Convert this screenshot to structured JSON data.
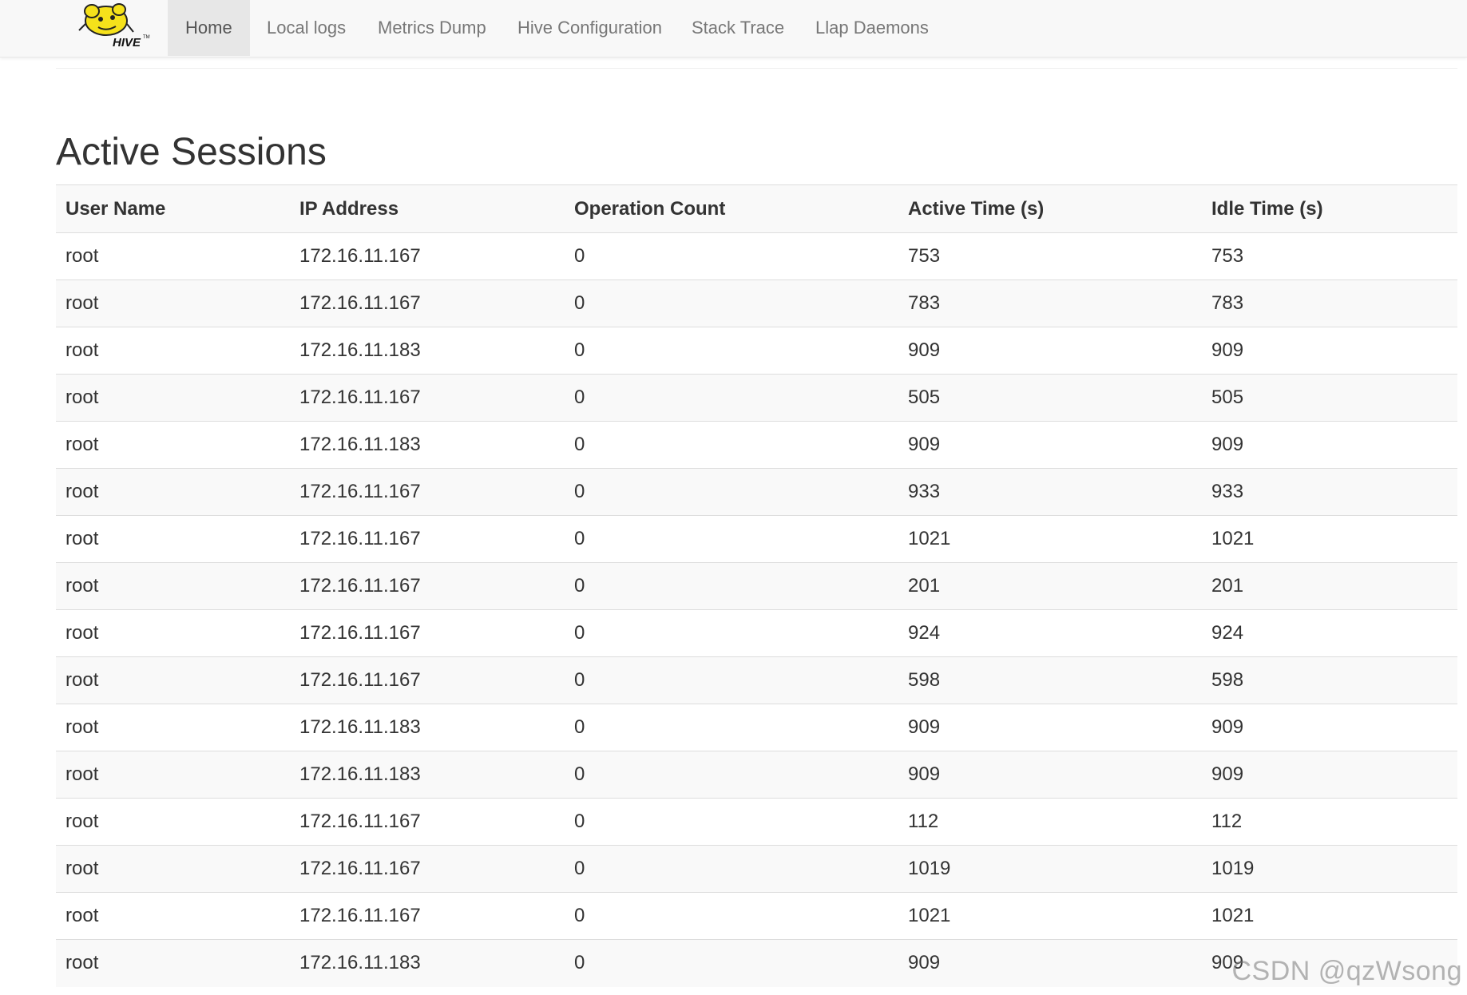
{
  "nav": {
    "logo_text": "HIVE",
    "items": [
      {
        "label": "Home",
        "active": true
      },
      {
        "label": "Local logs",
        "active": false
      },
      {
        "label": "Metrics Dump",
        "active": false
      },
      {
        "label": "Hive Configuration",
        "active": false
      },
      {
        "label": "Stack Trace",
        "active": false
      },
      {
        "label": "Llap Daemons",
        "active": false
      }
    ]
  },
  "page": {
    "title": "Active Sessions"
  },
  "table": {
    "columns": [
      "User Name",
      "IP Address",
      "Operation Count",
      "Active Time (s)",
      "Idle Time (s)"
    ],
    "rows": [
      [
        "root",
        "172.16.11.167",
        "0",
        "753",
        "753"
      ],
      [
        "root",
        "172.16.11.167",
        "0",
        "783",
        "783"
      ],
      [
        "root",
        "172.16.11.183",
        "0",
        "909",
        "909"
      ],
      [
        "root",
        "172.16.11.167",
        "0",
        "505",
        "505"
      ],
      [
        "root",
        "172.16.11.183",
        "0",
        "909",
        "909"
      ],
      [
        "root",
        "172.16.11.167",
        "0",
        "933",
        "933"
      ],
      [
        "root",
        "172.16.11.167",
        "0",
        "1021",
        "1021"
      ],
      [
        "root",
        "172.16.11.167",
        "0",
        "201",
        "201"
      ],
      [
        "root",
        "172.16.11.167",
        "0",
        "924",
        "924"
      ],
      [
        "root",
        "172.16.11.167",
        "0",
        "598",
        "598"
      ],
      [
        "root",
        "172.16.11.183",
        "0",
        "909",
        "909"
      ],
      [
        "root",
        "172.16.11.183",
        "0",
        "909",
        "909"
      ],
      [
        "root",
        "172.16.11.167",
        "0",
        "112",
        "112"
      ],
      [
        "root",
        "172.16.11.167",
        "0",
        "1019",
        "1019"
      ],
      [
        "root",
        "172.16.11.167",
        "0",
        "1021",
        "1021"
      ],
      [
        "root",
        "172.16.11.183",
        "0",
        "909",
        "909"
      ]
    ]
  },
  "watermark": "CSDN @qzWsong",
  "colors": {
    "navbar_bg": "#f8f8f8",
    "nav_active_bg": "#e7e7e7",
    "logo_yellow": "#f5e11b",
    "text": "#333333",
    "nav_text": "#777777"
  }
}
